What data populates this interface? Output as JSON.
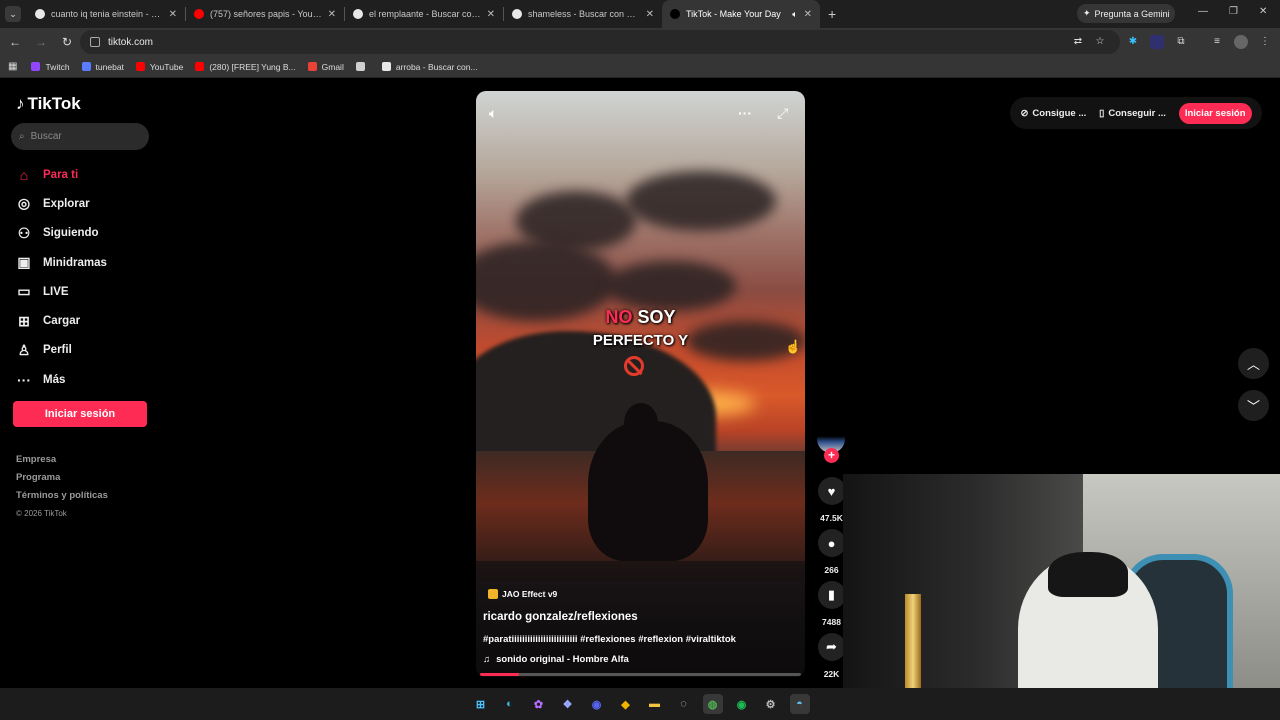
{
  "browser": {
    "tabs": [
      {
        "title": "cuanto iq tenia einstein - Busca",
        "favicon_color": "#e8e8e8"
      },
      {
        "title": "(757) señores papis - YouTube",
        "favicon_color": "#ff0000"
      },
      {
        "title": "el remplaante - Buscar con Goo",
        "favicon_color": "#e8e8e8"
      },
      {
        "title": "shameless - Buscar con Google",
        "favicon_color": "#e8e8e8"
      },
      {
        "title": "TikTok - Make Your Day",
        "favicon_color": "#000000",
        "active": true
      }
    ],
    "tab_close": "✕",
    "new_tab": "+",
    "gemini_label": "Pregunta a Gemini",
    "url": "tiktok.com",
    "bookmarks": [
      {
        "label": "Twitch",
        "color": "#9146ff"
      },
      {
        "label": "tunebat",
        "color": "#5a7cff"
      },
      {
        "label": "YouTube",
        "color": "#ff0000"
      },
      {
        "label": "(280) [FREE] Yung B...",
        "color": "#ff0000"
      },
      {
        "label": "Gmail",
        "color": "#ea4335"
      },
      {
        "label": "",
        "color": "#cfcfcf"
      },
      {
        "label": "arroba - Buscar con...",
        "color": "#e8e8e8"
      }
    ]
  },
  "tiktok": {
    "logo": "TikTok",
    "search_placeholder": "Buscar",
    "nav": [
      {
        "label": "Para ti",
        "icon": "home-icon",
        "glyph": "⌂",
        "active": true
      },
      {
        "label": "Explorar",
        "icon": "compass-icon",
        "glyph": "◎"
      },
      {
        "label": "Siguiendo",
        "icon": "following-icon",
        "glyph": "⚇"
      },
      {
        "label": "Minidramas",
        "icon": "minidrama-icon",
        "glyph": "▣"
      },
      {
        "label": "LIVE",
        "icon": "live-icon",
        "glyph": "▭"
      },
      {
        "label": "Cargar",
        "icon": "upload-icon",
        "glyph": "⊞"
      },
      {
        "label": "Perfil",
        "icon": "profile-icon",
        "glyph": "♙"
      },
      {
        "label": "Más",
        "icon": "more-icon",
        "glyph": "···"
      }
    ],
    "login_button": "Iniciar sesión",
    "footer": {
      "links": [
        "Empresa",
        "Programa",
        "Términos y políticas"
      ],
      "copyright": "© 2026 TikTok"
    },
    "header": {
      "coins": "Consigue ...",
      "app": "Conseguir ...",
      "login": "Iniciar sesión"
    },
    "video": {
      "caption_word1": "NO",
      "caption_word2": "SOY",
      "caption_line2": "PERFECTO Y",
      "effect": "JAO Effect v9",
      "author": "ricardo gonzalez/reflexiones",
      "hashtags": "#paratiiiiiiiiiiiiiiiiiiiiiiiii #reflexiones #reflexion #viraltiktok",
      "sound": "sonido original - Hombre Alfa",
      "progress": 0.12
    },
    "actions": {
      "likes": "47.5K",
      "comments": "266",
      "saves": "7488",
      "shares": "22K"
    }
  }
}
